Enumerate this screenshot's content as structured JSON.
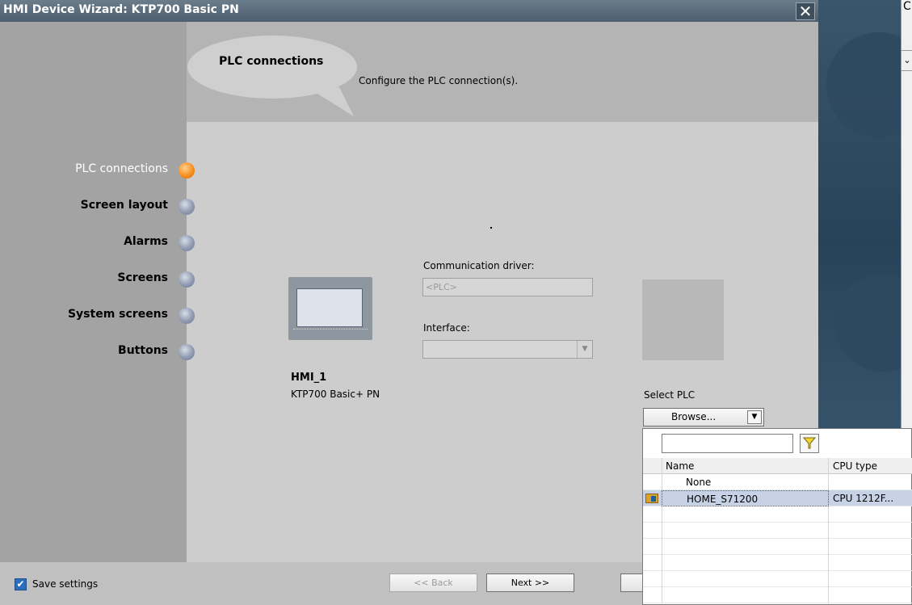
{
  "window": {
    "title": "HMI Device Wizard: KTP700 Basic PN",
    "close_symbol": "✕"
  },
  "header": {
    "title": "PLC connections",
    "description": "Configure the PLC connection(s)."
  },
  "steps": [
    {
      "label": "PLC connections",
      "active": true
    },
    {
      "label": "Screen layout",
      "active": false
    },
    {
      "label": "Alarms",
      "active": false
    },
    {
      "label": "Screens",
      "active": false
    },
    {
      "label": "System screens",
      "active": false
    },
    {
      "label": "Buttons",
      "active": false
    }
  ],
  "device": {
    "name": "HMI_1",
    "type": "KTP700 Basic+ PN"
  },
  "communication": {
    "driver_label": "Communication driver:",
    "driver_value": "<PLC>",
    "interface_label": "Interface:",
    "interface_value": ""
  },
  "select_plc": {
    "label": "Select PLC",
    "browse_label": "Browse...",
    "filter_placeholder": ""
  },
  "plc_table": {
    "columns": [
      "Name",
      "CPU type"
    ],
    "rows": [
      {
        "name": "None",
        "cpu": ""
      },
      {
        "name": "HOME_S71200",
        "cpu": "CPU 1212F...",
        "selected": true
      }
    ]
  },
  "footer": {
    "save_settings_label": "Save settings",
    "save_settings_checked": true,
    "back_label": "<< Back",
    "next_label": "Next >>"
  },
  "background": {
    "panel_mark_top": "C",
    "panel_mark_chevron": "⌄"
  }
}
